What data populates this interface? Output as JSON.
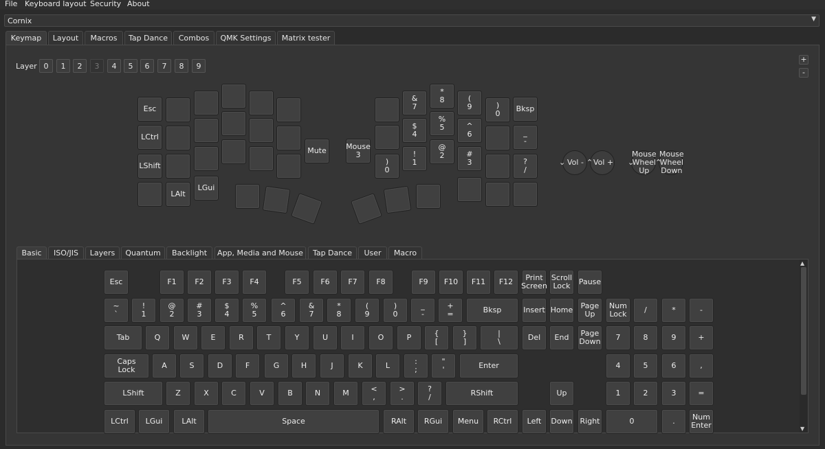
{
  "menu": [
    "File",
    "Keyboard layout",
    "Security",
    "About"
  ],
  "device": {
    "selected": "Cornix"
  },
  "main_tabs": [
    "Keymap",
    "Layout",
    "Macros",
    "Tap Dance",
    "Combos",
    "QMK Settings",
    "Matrix tester"
  ],
  "layer": {
    "label": "Layer",
    "buttons": [
      "0",
      "1",
      "2",
      "3",
      "4",
      "5",
      "6",
      "7",
      "8",
      "9"
    ],
    "active": "3"
  },
  "zoom": {
    "plus": "+",
    "minus": "-"
  },
  "keymap_keys": [
    "Esc",
    "",
    "",
    "",
    "",
    "",
    "LCtrl",
    "",
    "",
    "",
    "",
    "",
    "LShift",
    "",
    "",
    "",
    "",
    "",
    "",
    "LAlt",
    "LGui",
    "Mute",
    "",
    "",
    "",
    "",
    "&\n7",
    "*\n8",
    "(\n9",
    ")\n0",
    "Bksp",
    "",
    "$\n4",
    "%\n5",
    "^\n6",
    "",
    "_\n-",
    ")\n0",
    "!\n1",
    "@\n2",
    "#\n3",
    "",
    "?\n/",
    "",
    "",
    "Mouse\n3",
    "",
    "",
    "",
    ""
  ],
  "encoders": [
    {
      "ccw": "Vol -",
      "cw": "Vol +"
    },
    {
      "ccw": "Mouse\nWheel\nUp",
      "cw": "Mouse\nWheel\nDown"
    }
  ],
  "key_tabs": [
    "Basic",
    "ISO/JIS",
    "Layers",
    "Quantum",
    "Backlight",
    "App, Media and Mouse",
    "Tap Dance",
    "User",
    "Macro"
  ],
  "basic_keys": {
    "row1": [
      "Esc",
      "F1",
      "F2",
      "F3",
      "F4",
      "F5",
      "F6",
      "F7",
      "F8",
      "F9",
      "F10",
      "F11",
      "F12",
      "Print\nScreen",
      "Scroll\nLock",
      "Pause"
    ],
    "row2": [
      "~\n`",
      "!\n1",
      "@\n2",
      "#\n3",
      "$\n4",
      "%\n5",
      "^\n6",
      "&\n7",
      "*\n8",
      "(\n9",
      ")\n0",
      "_\n-",
      "+\n=",
      "Bksp",
      "Insert",
      "Home",
      "Page\nUp",
      "Num\nLock",
      "/",
      "*",
      "-"
    ],
    "row3": [
      "Tab",
      "Q",
      "W",
      "E",
      "R",
      "T",
      "Y",
      "U",
      "I",
      "O",
      "P",
      "{\n[",
      "}\n]",
      "|\n\\",
      "Del",
      "End",
      "Page\nDown",
      "7",
      "8",
      "9",
      "+"
    ],
    "row4": [
      "Caps\nLock",
      "A",
      "S",
      "D",
      "F",
      "G",
      "H",
      "J",
      "K",
      "L",
      ":\n;",
      "\"\n'",
      "Enter",
      "4",
      "5",
      "6",
      ","
    ],
    "row5": [
      "LShift",
      "Z",
      "X",
      "C",
      "V",
      "B",
      "N",
      "M",
      "<\n,",
      ">\n.",
      "?\n/",
      "RShift",
      "Up",
      "1",
      "2",
      "3",
      "="
    ],
    "row6": [
      "LCtrl",
      "LGui",
      "LAlt",
      "Space",
      "RAlt",
      "RGui",
      "Menu",
      "RCtrl",
      "Left",
      "Down",
      "Right",
      "0",
      ".",
      "Num\nEnter"
    ]
  }
}
